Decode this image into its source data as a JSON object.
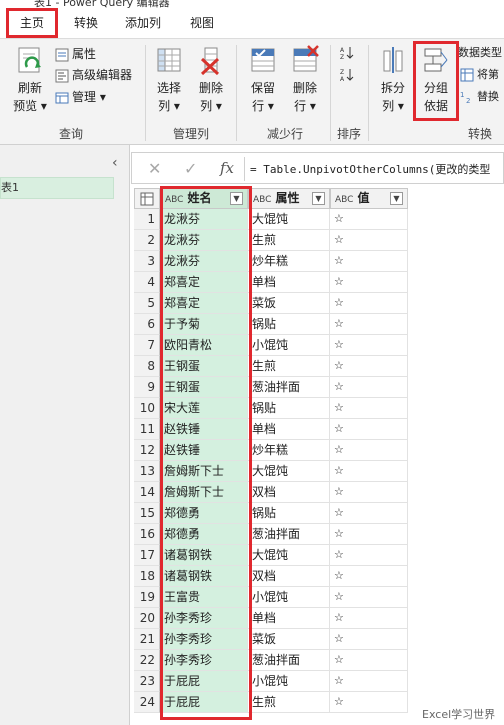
{
  "window": {
    "title": "表1 - Power Query 编辑器"
  },
  "tabs": [
    {
      "label": "主页",
      "active": true
    },
    {
      "label": "转换",
      "active": false
    },
    {
      "label": "添加列",
      "active": false
    },
    {
      "label": "视图",
      "active": false
    }
  ],
  "ribbon": {
    "refresh": {
      "line1": "刷新",
      "line2": "预览 ▾"
    },
    "properties": "属性",
    "advanced_editor": "高级编辑器",
    "manage": "管理 ▾",
    "query_group": "查询",
    "choose_columns": {
      "line1": "选择",
      "line2": "列 ▾"
    },
    "remove_columns": {
      "line1": "删除",
      "line2": "列 ▾"
    },
    "manage_columns_group": "管理列",
    "keep_rows": {
      "line1": "保留",
      "line2": "行 ▾"
    },
    "remove_rows": {
      "line1": "删除",
      "line2": "行 ▾"
    },
    "reduce_rows_group": "减少行",
    "sort_group": "排序",
    "split_column": {
      "line1": "拆分",
      "line2": "列 ▾"
    },
    "group_by": {
      "line1": "分组",
      "line2": "依据"
    },
    "data_type": "数据类型",
    "use_first_row": "将第",
    "replace": "替换",
    "transform_group": "转换"
  },
  "left_pane": {
    "query_name": "表1",
    "collapse_glyph": "‹"
  },
  "formula_bar": {
    "cancel_glyph": "✕",
    "confirm_glyph": "✓",
    "fx_glyph": "fx",
    "formula": "= Table.UnpivotOtherColumns(更改的类型"
  },
  "table": {
    "columns": [
      {
        "type_glyph": "ABC",
        "name": "姓名"
      },
      {
        "type_glyph": "ABC",
        "name": "属性"
      },
      {
        "type_glyph": "ABC",
        "name": "值"
      }
    ],
    "rows": [
      {
        "n": "1",
        "name": "龙湫芬",
        "attr": "大馄饨",
        "val": "☆"
      },
      {
        "n": "2",
        "name": "龙湫芬",
        "attr": "生煎",
        "val": "☆"
      },
      {
        "n": "3",
        "name": "龙湫芬",
        "attr": "炒年糕",
        "val": "☆"
      },
      {
        "n": "4",
        "name": "郑喜定",
        "attr": "单档",
        "val": "☆"
      },
      {
        "n": "5",
        "name": "郑喜定",
        "attr": "菜饭",
        "val": "☆"
      },
      {
        "n": "6",
        "name": "于予菊",
        "attr": "锅贴",
        "val": "☆"
      },
      {
        "n": "7",
        "name": "欧阳青松",
        "attr": "小馄饨",
        "val": "☆"
      },
      {
        "n": "8",
        "name": "王钢蛋",
        "attr": "生煎",
        "val": "☆"
      },
      {
        "n": "9",
        "name": "王钢蛋",
        "attr": "葱油拌面",
        "val": "☆"
      },
      {
        "n": "10",
        "name": "宋大莲",
        "attr": "锅贴",
        "val": "☆"
      },
      {
        "n": "11",
        "name": "赵铁锤",
        "attr": "单档",
        "val": "☆"
      },
      {
        "n": "12",
        "name": "赵铁锤",
        "attr": "炒年糕",
        "val": "☆"
      },
      {
        "n": "13",
        "name": "詹姆斯下士",
        "attr": "大馄饨",
        "val": "☆"
      },
      {
        "n": "14",
        "name": "詹姆斯下士",
        "attr": "双档",
        "val": "☆"
      },
      {
        "n": "15",
        "name": "郑德勇",
        "attr": "锅贴",
        "val": "☆"
      },
      {
        "n": "16",
        "name": "郑德勇",
        "attr": "葱油拌面",
        "val": "☆"
      },
      {
        "n": "17",
        "name": "诸葛钢铁",
        "attr": "大馄饨",
        "val": "☆"
      },
      {
        "n": "18",
        "name": "诸葛钢铁",
        "attr": "双档",
        "val": "☆"
      },
      {
        "n": "19",
        "name": "王富贵",
        "attr": "小馄饨",
        "val": "☆"
      },
      {
        "n": "20",
        "name": "孙李秀珍",
        "attr": "单档",
        "val": "☆"
      },
      {
        "n": "21",
        "name": "孙李秀珍",
        "attr": "菜饭",
        "val": "☆"
      },
      {
        "n": "22",
        "name": "孙李秀珍",
        "attr": "葱油拌面",
        "val": "☆"
      },
      {
        "n": "23",
        "name": "于屁屁",
        "attr": "小馄饨",
        "val": "☆"
      },
      {
        "n": "24",
        "name": "于屁屁",
        "attr": "生煎",
        "val": "☆"
      }
    ]
  },
  "watermark": "Excel学习世界",
  "colors": {
    "highlight_red": "#e0282e",
    "name_column_fill": "#d4f0df",
    "ribbon_bg": "#f3f3f3"
  }
}
